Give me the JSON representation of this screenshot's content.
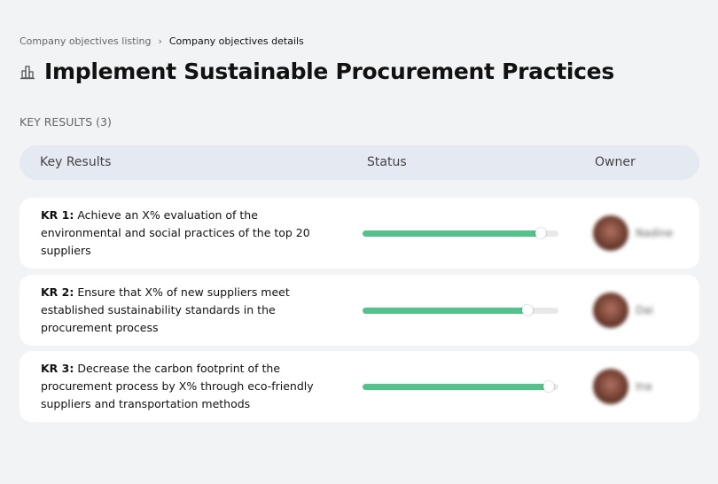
{
  "breadcrumb": {
    "items": [
      "Company objectives listing",
      "Company objectives details"
    ],
    "separator": "›"
  },
  "page": {
    "title": "Implement Sustainable Procurement Practices",
    "icon": "buildings-icon"
  },
  "key_results_count_label": "KEY RESULTS (3)",
  "table": {
    "headers": {
      "key_results": "Key Results",
      "status": "Status",
      "owner": "Owner"
    },
    "accent_color": "#55c28c",
    "rows": [
      {
        "kr": "KR 1:",
        "text": " Achieve an X% evaluation of the environmental and social practices of the top 20 suppliers",
        "progress": 91,
        "owner": "Nadine"
      },
      {
        "kr": "KR 2:",
        "text": " Ensure that X% of new suppliers meet established sustainability standards in the procurement process",
        "progress": 84,
        "owner": "Dai"
      },
      {
        "kr": "KR 3:",
        "text": " Decrease the carbon footprint of the procurement process by X% through eco-friendly suppliers and transportation methods",
        "progress": 95,
        "owner": "Ina"
      }
    ]
  }
}
